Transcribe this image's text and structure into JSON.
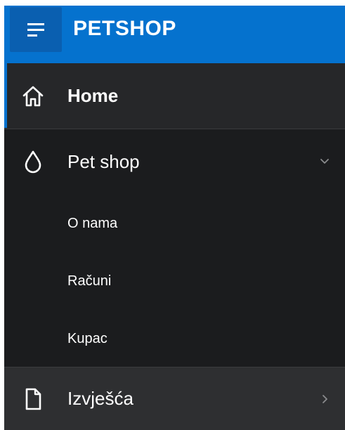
{
  "app": {
    "title": "PETSHOP"
  },
  "nav": {
    "items": [
      {
        "label": "Home",
        "icon": "home-icon",
        "active": true
      },
      {
        "label": "Pet shop",
        "icon": "drop-icon",
        "expanded": true,
        "children": [
          {
            "label": "O nama"
          },
          {
            "label": "Računi"
          },
          {
            "label": "Kupac"
          }
        ]
      },
      {
        "label": "Izvješća",
        "icon": "document-icon",
        "expanded": false
      }
    ]
  },
  "colors": {
    "header": "#0572ce",
    "menu_button": "#0a5fb0",
    "nav_background": "#1b1c1e",
    "active_item": "#262729",
    "collapsed_item": "#2e2f31"
  }
}
